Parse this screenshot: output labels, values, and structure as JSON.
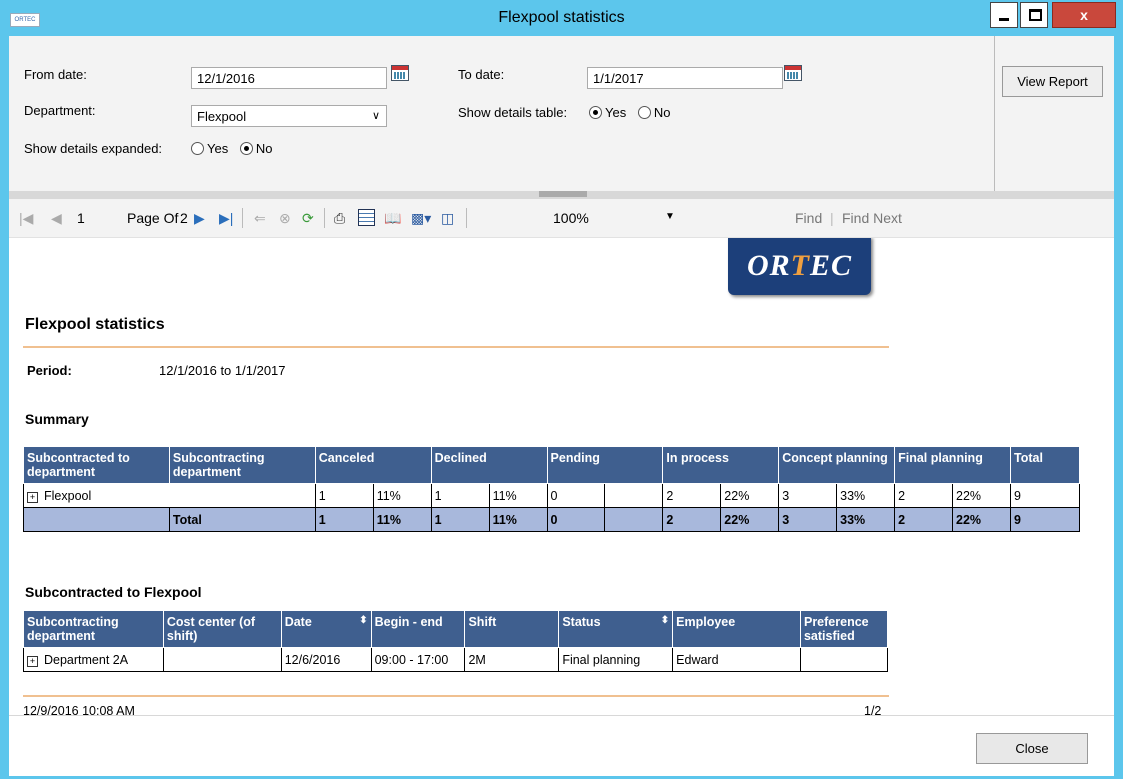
{
  "window": {
    "title": "Flexpool statistics",
    "app_icon_text": "ORTEC",
    "close_glyph": "x"
  },
  "params": {
    "from_date_label": "From date:",
    "from_date_value": "12/1/2016",
    "to_date_label": "To date:",
    "to_date_value": "1/1/2017",
    "department_label": "Department:",
    "department_value": "Flexpool",
    "show_details_table_label": "Show details table:",
    "show_details_table_yes": "Yes",
    "show_details_table_no": "No",
    "show_details_table_selected": "Yes",
    "show_details_expanded_label": "Show details expanded:",
    "show_details_expanded_yes": "Yes",
    "show_details_expanded_no": "No",
    "show_details_expanded_selected": "No",
    "view_report_label": "View Report"
  },
  "toolbar": {
    "current_page": "1",
    "page_of_label": "Page Of",
    "total_pages": "2",
    "zoom_value": "100%",
    "find_label": "Find",
    "find_separator": "|",
    "find_next_label": "Find Next"
  },
  "report": {
    "logo_text_a": "OR",
    "logo_text_e": "T",
    "logo_text_b": "EC",
    "title": "Flexpool statistics",
    "period_label": "Period:",
    "period_value": "12/1/2016 to 1/1/2017",
    "summary_heading": "Summary",
    "summary": {
      "headers": [
        "Subcontracted to department",
        "Subcontracting department",
        "Canceled",
        "Declined",
        "Pending",
        "In process",
        "Concept planning",
        "Final planning",
        "Total"
      ],
      "rows": [
        {
          "dept": "Flexpool",
          "cells": [
            "1",
            "11%",
            "1",
            "11%",
            "0",
            "",
            "2",
            "22%",
            "3",
            "33%",
            "2",
            "22%",
            "9"
          ]
        }
      ],
      "total": {
        "label": "Total",
        "cells": [
          "1",
          "11%",
          "1",
          "11%",
          "0",
          "",
          "2",
          "22%",
          "3",
          "33%",
          "2",
          "22%",
          "9"
        ]
      }
    },
    "detail_heading": "Subcontracted to Flexpool",
    "detail": {
      "headers": [
        "Subcontracting department",
        "Cost center (of shift)",
        "Date",
        "Begin - end",
        "Shift",
        "Status",
        "Employee",
        "Preference satisfied"
      ],
      "rows": [
        [
          "Department 2A",
          "",
          "12/6/2016",
          "09:00 - 17:00",
          "2M",
          "Final planning",
          "Edward",
          ""
        ]
      ]
    },
    "footer_timestamp": "12/9/2016 10:08 AM",
    "footer_page": "1/2"
  },
  "bottom": {
    "close_label": "Close"
  }
}
